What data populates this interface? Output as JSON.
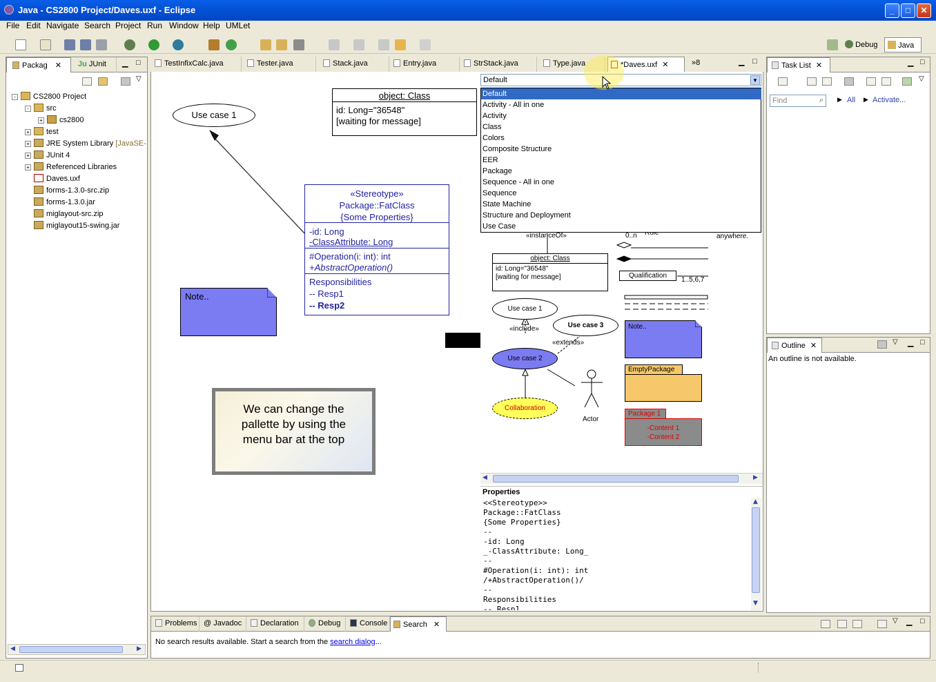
{
  "window": {
    "title": "Java - CS2800 Project/Daves.uxf - Eclipse",
    "min": "_",
    "max": "□",
    "close": "✕"
  },
  "menu": [
    "File",
    "Edit",
    "Navigate",
    "Search",
    "Project",
    "Run",
    "Window",
    "Help",
    "UMLet"
  ],
  "perspectives": {
    "debug": "Debug",
    "java": "Java"
  },
  "left_panel": {
    "tabs": [
      {
        "label": "Packag"
      },
      {
        "label": "JUnit",
        "prefix": "Ju"
      }
    ],
    "tree": [
      {
        "label": "CS2800 Project",
        "level": 0,
        "exp": "-"
      },
      {
        "label": "src",
        "level": 1,
        "exp": "-"
      },
      {
        "label": "cs2800",
        "level": 2,
        "exp": "+"
      },
      {
        "label": "test",
        "level": 1,
        "exp": "+"
      },
      {
        "label": "JRE System Library",
        "suffix": " [JavaSE-",
        "level": 1,
        "exp": "+"
      },
      {
        "label": "JUnit 4",
        "level": 1,
        "exp": "+"
      },
      {
        "label": "Referenced Libraries",
        "level": 1,
        "exp": "+"
      },
      {
        "label": "Daves.uxf",
        "level": 1,
        "exp": ""
      },
      {
        "label": "forms-1.3.0-src.zip",
        "level": 1,
        "exp": ""
      },
      {
        "label": "forms-1.3.0.jar",
        "level": 1,
        "exp": ""
      },
      {
        "label": "miglayout-src.zip",
        "level": 1,
        "exp": ""
      },
      {
        "label": "miglayout15-swing.jar",
        "level": 1,
        "exp": ""
      }
    ]
  },
  "editor_tabs": [
    "TestInfixCalc.java",
    "Tester.java",
    "Stack.java",
    "Entry.java",
    "StrStack.java",
    "Type.java",
    "*Daves.uxf"
  ],
  "editor_overflow": "»8",
  "canvas": {
    "use_case_1": "Use case 1",
    "object_class": {
      "title": "object: Class",
      "line1": "id: Long=\"36548\"",
      "line2": "[waiting for message]"
    },
    "fat_class": {
      "stereotype": "«Stereotype»",
      "name": "Package::FatClass",
      "props": "{Some Properties}",
      "attr1": "-id: Long",
      "attr2": "-ClassAttribute: Long",
      "op1": "#Operation(i: int): int",
      "op2": "+AbstractOperation()",
      "resp": "Responsibilities",
      "resp1": "-- Resp1",
      "resp2": "-- Resp2"
    },
    "note": "Note..",
    "callout": "We can change the pallette by using the menu bar at the top"
  },
  "palette_dropdown": {
    "selected": "Default",
    "options": [
      "Default",
      "Activity - All in one",
      "Activity",
      "Class",
      "Colors",
      "Composite Structure",
      "EER",
      "Package",
      "Sequence - All in one",
      "Sequence",
      "State Machine",
      "Structure and Deployment",
      "Use Case"
    ]
  },
  "palette": {
    "instance_of": "«instanceOf»",
    "zero_n": "0..n",
    "role": "Role",
    "anywhere": "anywhere.",
    "object_title": "object: Class",
    "object_l1": "id: Long=\"36548\"",
    "object_l2": "[waiting for message]",
    "qualification": "Qualification",
    "qual_mult": "1..5,6,7",
    "uc1": "Use case 1",
    "uc2": "Use case 2",
    "uc3": "Use case 3",
    "include": "«include»",
    "extends": "«extends»",
    "note": "Note..",
    "empty_package": "EmptyPackage",
    "collaboration": "Collaboration",
    "actor": "Actor",
    "package1": "Package 1",
    "content1": "-Content 1",
    "content2": "-Content 2"
  },
  "properties": {
    "header": "Properties",
    "text": "<<Stereotype>>\nPackage::FatClass\n{Some Properties}\n--\n-id: Long\n_-ClassAttribute: Long_\n--\n#Operation(i: int): int\n/+AbstractOperation()/\n--\nResponsibilities\n-- Resp1"
  },
  "tasklist": {
    "tab": "Task List",
    "find_placeholder": "Find",
    "all": "All",
    "activate": "Activate..."
  },
  "outline": {
    "tab": "Outline",
    "message": "An outline is not available."
  },
  "bottom_tabs": [
    "Problems",
    "Javadoc",
    "Declaration",
    "Debug",
    "Console",
    "Search"
  ],
  "search_msg": {
    "prefix": "No search results available. Start a search from the ",
    "link": "search dialog",
    "suffix": "..."
  }
}
